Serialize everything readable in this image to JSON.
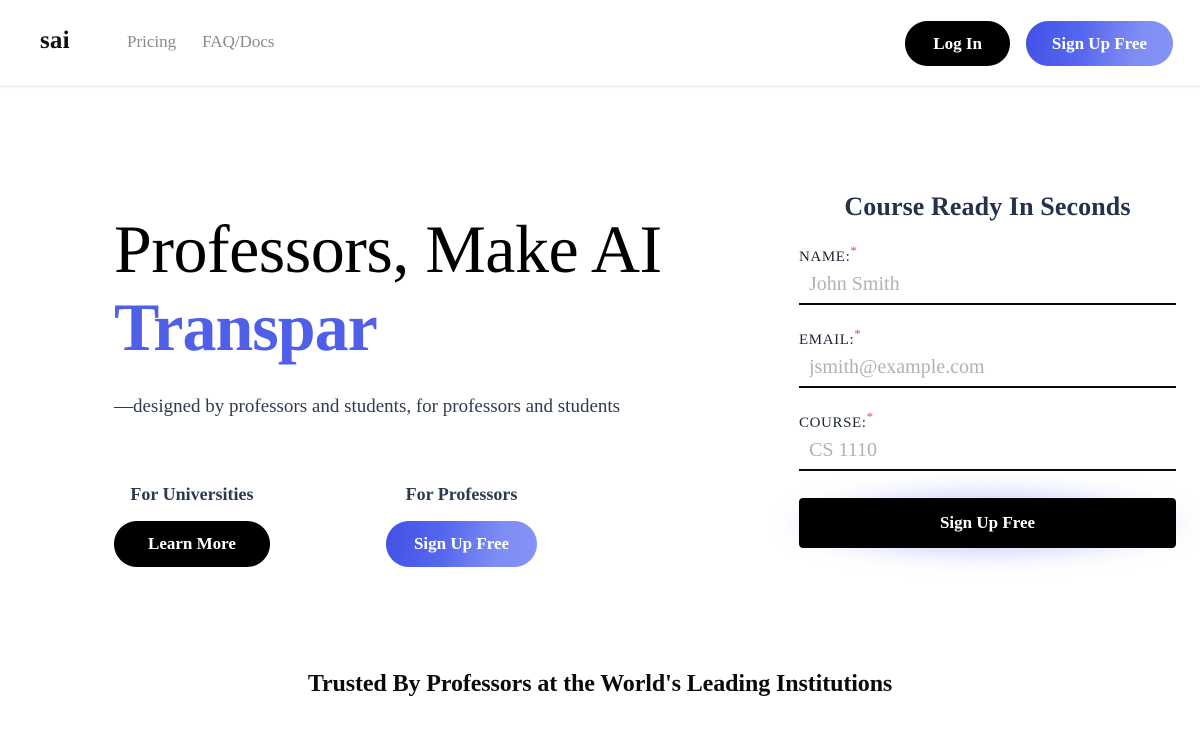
{
  "brand": {
    "name": "sai"
  },
  "nav": {
    "links": [
      {
        "label": "Pricing",
        "name": "nav-link-pricing"
      },
      {
        "label": "FAQ/Docs",
        "name": "nav-link-faq-docs"
      }
    ],
    "login_label": "Log In",
    "signup_label": "Sign Up Free"
  },
  "hero": {
    "headline_static": "Professors, Make AI",
    "headline_animated": "Transpar",
    "subtitle": "—designed by professors and students, for professors and students",
    "cta": [
      {
        "label": "For Universities",
        "button": "Learn More",
        "style": "black"
      },
      {
        "label": "For Professors",
        "button": "Sign Up Free",
        "style": "blue"
      }
    ]
  },
  "form": {
    "title": "Course Ready In Seconds",
    "required_marker": "*",
    "fields": [
      {
        "label": "NAME:",
        "placeholder": "John Smith",
        "value": "",
        "type": "text",
        "name": "name-field"
      },
      {
        "label": "EMAIL:",
        "placeholder": "jsmith@example.com",
        "value": "",
        "type": "email",
        "name": "email-field"
      },
      {
        "label": "COURSE:",
        "placeholder": "CS 1110",
        "value": "",
        "type": "text",
        "name": "course-field"
      }
    ],
    "submit_label": "Sign Up Free"
  },
  "trust": {
    "heading": "Trusted By Professors at the World's Leading Institutions"
  },
  "colors": {
    "accent_blue": "#4f5fe8",
    "accent_blue_light": "#7a89f5",
    "black": "#000000",
    "slate": "#2c3a4f",
    "muted_gray": "#8a8a90",
    "placeholder_gray": "#b1b2b8",
    "required_red": "#e4544a",
    "page_bg": "#ffffff"
  }
}
